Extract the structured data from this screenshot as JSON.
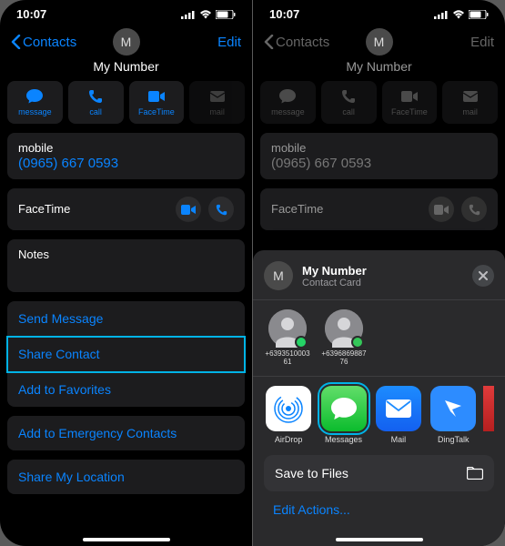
{
  "status": {
    "time": "10:07"
  },
  "nav": {
    "back": "Contacts",
    "edit": "Edit",
    "name": "My Number",
    "initial": "M"
  },
  "actions": {
    "message": "message",
    "call": "call",
    "facetime": "FaceTime",
    "mail": "mail"
  },
  "phone_card": {
    "label": "mobile",
    "value": "(0965) 667 0593"
  },
  "facetime_card": {
    "label": "FaceTime"
  },
  "notes_card": {
    "label": "Notes"
  },
  "links1": {
    "send_message": "Send Message",
    "share_contact": "Share Contact",
    "add_favorites": "Add to Favorites"
  },
  "links2": {
    "add_emergency": "Add to Emergency Contacts"
  },
  "links3": {
    "share_location": "Share My Location"
  },
  "share_sheet": {
    "title": "My Number",
    "subtitle": "Contact Card",
    "initial": "M",
    "contacts": [
      {
        "name": "+639351000361"
      },
      {
        "name": "+639686988776"
      }
    ],
    "apps": {
      "airdrop": "AirDrop",
      "messages": "Messages",
      "mail": "Mail",
      "dingtalk": "DingTalk"
    },
    "save_files": "Save to Files",
    "edit_actions": "Edit Actions..."
  }
}
